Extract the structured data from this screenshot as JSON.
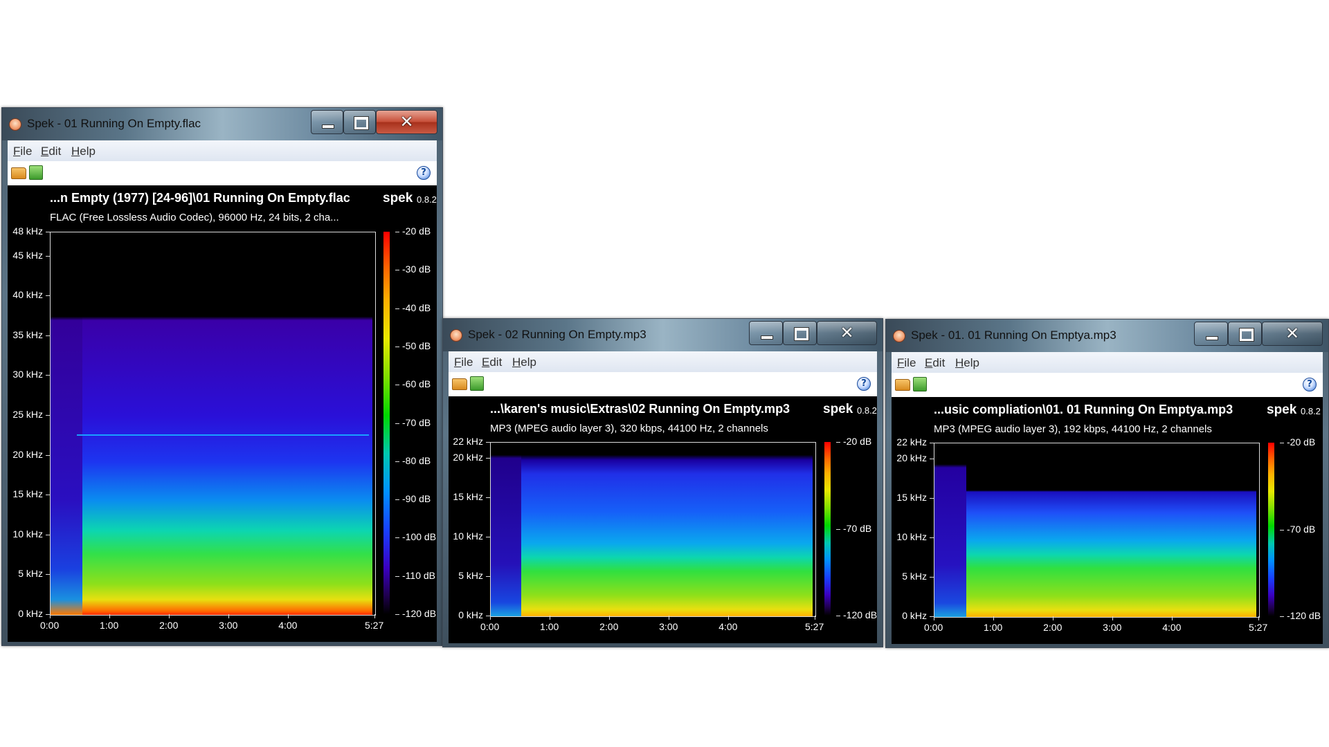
{
  "windows": [
    {
      "id": "win1",
      "title": "Spek - 01 Running On Empty.flac",
      "menu": [
        "File",
        "Edit",
        "Help"
      ],
      "toolbar_icons": [
        "open-icon",
        "save-icon",
        "help-icon"
      ],
      "file_title": "...n Empty (1977) [24-96]\\01 Running On Empty.flac",
      "file_info": "FLAC (Free Lossless Audio Codec), 96000 Hz, 24 bits, 2 cha...",
      "brand": "spek",
      "version": "0.8.2",
      "freq_labels": [
        "48 kHz",
        "45 kHz",
        "40 kHz",
        "35 kHz",
        "30 kHz",
        "25 kHz",
        "20 kHz",
        "15 kHz",
        "10 kHz",
        "5 kHz",
        "0 kHz"
      ],
      "freq_values_khz": [
        48,
        45,
        40,
        35,
        30,
        25,
        20,
        15,
        10,
        5,
        0
      ],
      "time_labels": [
        "0:00",
        "1:00",
        "2:00",
        "3:00",
        "4:00",
        "5:27"
      ],
      "time_values_s": [
        0,
        60,
        120,
        180,
        240,
        327
      ],
      "db_labels": [
        "-20 dB",
        "-30 dB",
        "-40 dB",
        "-50 dB",
        "-60 dB",
        "-70 dB",
        "-80 dB",
        "-90 dB",
        "-100 dB",
        "-110 dB",
        "-120 dB"
      ],
      "db_values": [
        -20,
        -30,
        -40,
        -50,
        -60,
        -70,
        -80,
        -90,
        -100,
        -110,
        -120
      ],
      "max_freq_khz": 48,
      "duration_s": 327
    },
    {
      "id": "win2",
      "title": "Spek - 02 Running On Empty.mp3",
      "menu": [
        "File",
        "Edit",
        "Help"
      ],
      "toolbar_icons": [
        "open-icon",
        "save-icon",
        "help-icon"
      ],
      "file_title": "...\\karen's music\\Extras\\02 Running On Empty.mp3",
      "file_info": "MP3 (MPEG audio layer 3), 320 kbps, 44100 Hz, 2 channels",
      "brand": "spek",
      "version": "0.8.2",
      "freq_labels": [
        "22 kHz",
        "20 kHz",
        "15 kHz",
        "10 kHz",
        "5 kHz",
        "0 kHz"
      ],
      "freq_values_khz": [
        22,
        20,
        15,
        10,
        5,
        0
      ],
      "time_labels": [
        "0:00",
        "1:00",
        "2:00",
        "3:00",
        "4:00",
        "5:27"
      ],
      "time_values_s": [
        0,
        60,
        120,
        180,
        240,
        327
      ],
      "db_labels": [
        "-20 dB",
        "-70 dB",
        "-120 dB"
      ],
      "db_values": [
        -20,
        -70,
        -120
      ],
      "max_freq_khz": 22,
      "duration_s": 327
    },
    {
      "id": "win3",
      "title": "Spek - 01. 01 Running On Emptya.mp3",
      "menu": [
        "File",
        "Edit",
        "Help"
      ],
      "toolbar_icons": [
        "open-icon",
        "save-icon",
        "help-icon"
      ],
      "file_title": "...usic compliation\\01. 01 Running On Emptya.mp3",
      "file_info": "MP3 (MPEG audio layer 3), 192 kbps, 44100 Hz, 2 channels",
      "brand": "spek",
      "version": "0.8.2",
      "freq_labels": [
        "22 kHz",
        "20 kHz",
        "15 kHz",
        "10 kHz",
        "5 kHz",
        "0 kHz"
      ],
      "freq_values_khz": [
        22,
        20,
        15,
        10,
        5,
        0
      ],
      "time_labels": [
        "0:00",
        "1:00",
        "2:00",
        "3:00",
        "4:00",
        "5:27"
      ],
      "time_values_s": [
        0,
        60,
        120,
        180,
        240,
        327
      ],
      "db_labels": [
        "-20 dB",
        "-70 dB",
        "-120 dB"
      ],
      "db_values": [
        -20,
        -70,
        -120
      ],
      "max_freq_khz": 22,
      "duration_s": 327
    }
  ]
}
